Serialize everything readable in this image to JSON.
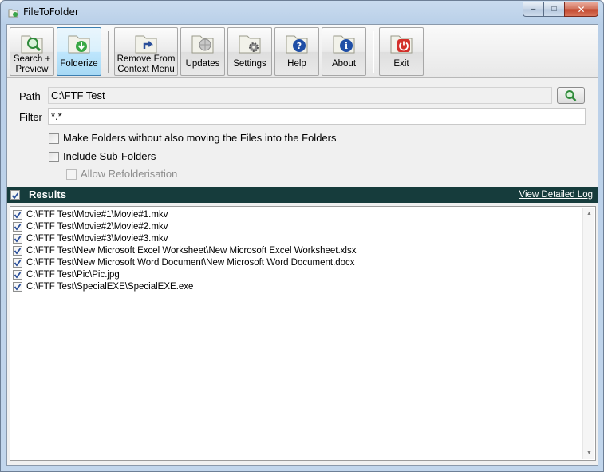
{
  "window": {
    "title": "FileToFolder",
    "controls": {
      "minimize": "–",
      "maximize": "□",
      "close": "✕"
    }
  },
  "toolbar": {
    "buttons": [
      {
        "label_line1": "Search +",
        "label_line2": "Preview",
        "icon": "magnifier-folder-icon"
      },
      {
        "label_line1": "Folderize",
        "label_line2": "",
        "icon": "folderize-download-icon",
        "active": true
      },
      {
        "label_line1": "Remove From",
        "label_line2": "Context Menu",
        "icon": "remove-context-menu-icon"
      },
      {
        "label_line1": "Updates",
        "label_line2": "",
        "icon": "updates-globe-icon"
      },
      {
        "label_line1": "Settings",
        "label_line2": "",
        "icon": "settings-gear-icon"
      },
      {
        "label_line1": "Help",
        "label_line2": "",
        "icon": "help-question-icon"
      },
      {
        "label_line1": "About",
        "label_line2": "",
        "icon": "about-info-icon"
      },
      {
        "label_line1": "Exit",
        "label_line2": "",
        "icon": "exit-power-icon"
      }
    ]
  },
  "form": {
    "path_label": "Path",
    "path_value": "C:\\FTF Test",
    "filter_label": "Filter",
    "filter_value": "*.*",
    "options": [
      {
        "label": "Make Folders without also moving the Files into the Folders",
        "checked": false,
        "enabled": true
      },
      {
        "label": "Include Sub-Folders",
        "checked": false,
        "enabled": true
      },
      {
        "label": "Allow Refolderisation",
        "checked": false,
        "enabled": false
      }
    ]
  },
  "results": {
    "title": "Results",
    "all_checked": true,
    "detail_link": "View Detailed Log",
    "items": [
      "C:\\FTF Test\\Movie#1\\Movie#1.mkv",
      "C:\\FTF Test\\Movie#2\\Movie#2.mkv",
      "C:\\FTF Test\\Movie#3\\Movie#3.mkv",
      "C:\\FTF Test\\New Microsoft Excel Worksheet\\New Microsoft Excel Worksheet.xlsx",
      "C:\\FTF Test\\New Microsoft Word Document\\New Microsoft Word Document.docx",
      "C:\\FTF Test\\Pic\\Pic.jpg",
      "C:\\FTF Test\\SpecialEXE\\SpecialEXE.exe"
    ]
  },
  "colors": {
    "results_bar": "#163c3c",
    "check_blue": "#2a4f9a",
    "active_button": "#3c7fb1"
  }
}
